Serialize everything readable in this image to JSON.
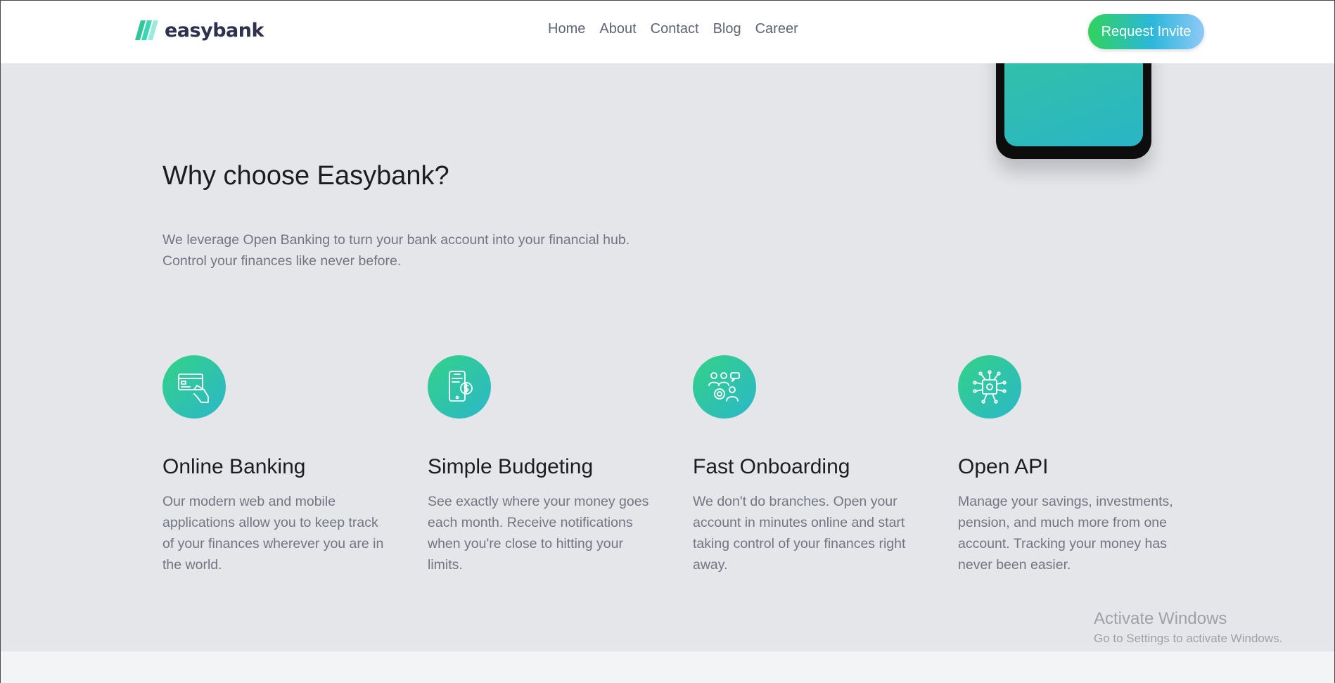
{
  "header": {
    "logo_text": "easybank",
    "nav": [
      {
        "label": "Home"
      },
      {
        "label": "About"
      },
      {
        "label": "Contact"
      },
      {
        "label": "Blog"
      },
      {
        "label": "Career"
      }
    ],
    "cta_label": "Request Invite"
  },
  "section": {
    "title": "Why choose Easybank?",
    "intro": "We leverage Open Banking to turn your bank account into your financial hub. Control your finances like never before."
  },
  "features": [
    {
      "icon": "online-banking-icon",
      "title": "Online Banking",
      "desc": "Our modern web and mobile applications allow you to keep track of your finances wherever you are in the world."
    },
    {
      "icon": "budgeting-icon",
      "title": "Simple Budgeting",
      "desc": "See exactly where your money goes each month. Receive notifications when you're close to hitting your limits."
    },
    {
      "icon": "onboarding-icon",
      "title": "Fast Onboarding",
      "desc": "We don't do branches. Open your account in minutes online and start taking control of your finances right away."
    },
    {
      "icon": "api-icon",
      "title": "Open API",
      "desc": "Manage your savings, investments, pension, and much more from one account. Tracking your money has never been easier."
    }
  ],
  "watermark": {
    "title": "Activate Windows",
    "subtitle": "Go to Settings to activate Windows."
  },
  "colors": {
    "brand_dark": "#2d314d",
    "gradient_start": "#31d35c",
    "gradient_end": "#2bb7da",
    "page_bg": "#e5e6ea",
    "body_text": "#727582"
  }
}
